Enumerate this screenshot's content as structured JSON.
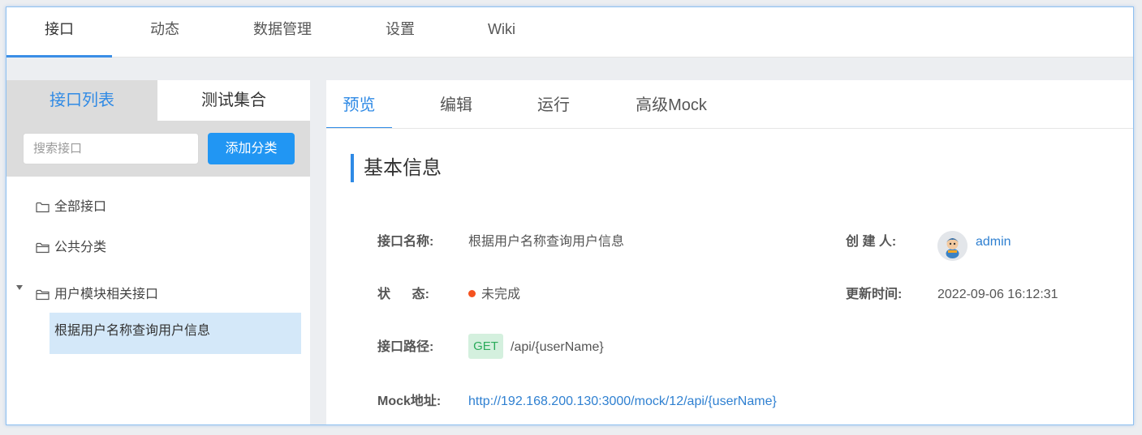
{
  "topnav": {
    "tabs": [
      "接口",
      "动态",
      "数据管理",
      "设置",
      "Wiki"
    ],
    "active_index": 0
  },
  "left": {
    "tabs": [
      "接口列表",
      "测试集合"
    ],
    "search_placeholder": "搜索接口",
    "add_button": "添加分类",
    "tree": {
      "all": "全部接口",
      "public": "公共分类",
      "user_module": "用户模块相关接口",
      "selected_child": "根据用户名称查询用户信息"
    }
  },
  "right": {
    "tabs": [
      "预览",
      "编辑",
      "运行",
      "高级Mock"
    ],
    "active_index": 0,
    "section_title": "基本信息",
    "fields": {
      "name_label": "接口名称:",
      "name_value": "根据用户名称查询用户信息",
      "creator_label": "创 建 人:",
      "creator_value": "admin",
      "status_label": "状      态:",
      "status_value": "未完成",
      "updated_label": "更新时间:",
      "updated_value": "2022-09-06 16:12:31",
      "path_label": "接口路径:",
      "method": "GET",
      "path_value": "/api/{userName}",
      "mock_label": "Mock地址:",
      "mock_value": "http://192.168.200.130:3000/mock/12/api/{userName}"
    }
  },
  "colors": {
    "accent": "#2f8ae5",
    "button": "#2196f3",
    "status_dot": "#f5521f",
    "get_badge_bg": "#d4f0de",
    "get_badge_text": "#2bab5b",
    "selected_bg": "#d4e8f9"
  },
  "icons": {
    "folder": "folder-icon",
    "caret": "caret-down-icon",
    "avatar": "user-avatar"
  }
}
